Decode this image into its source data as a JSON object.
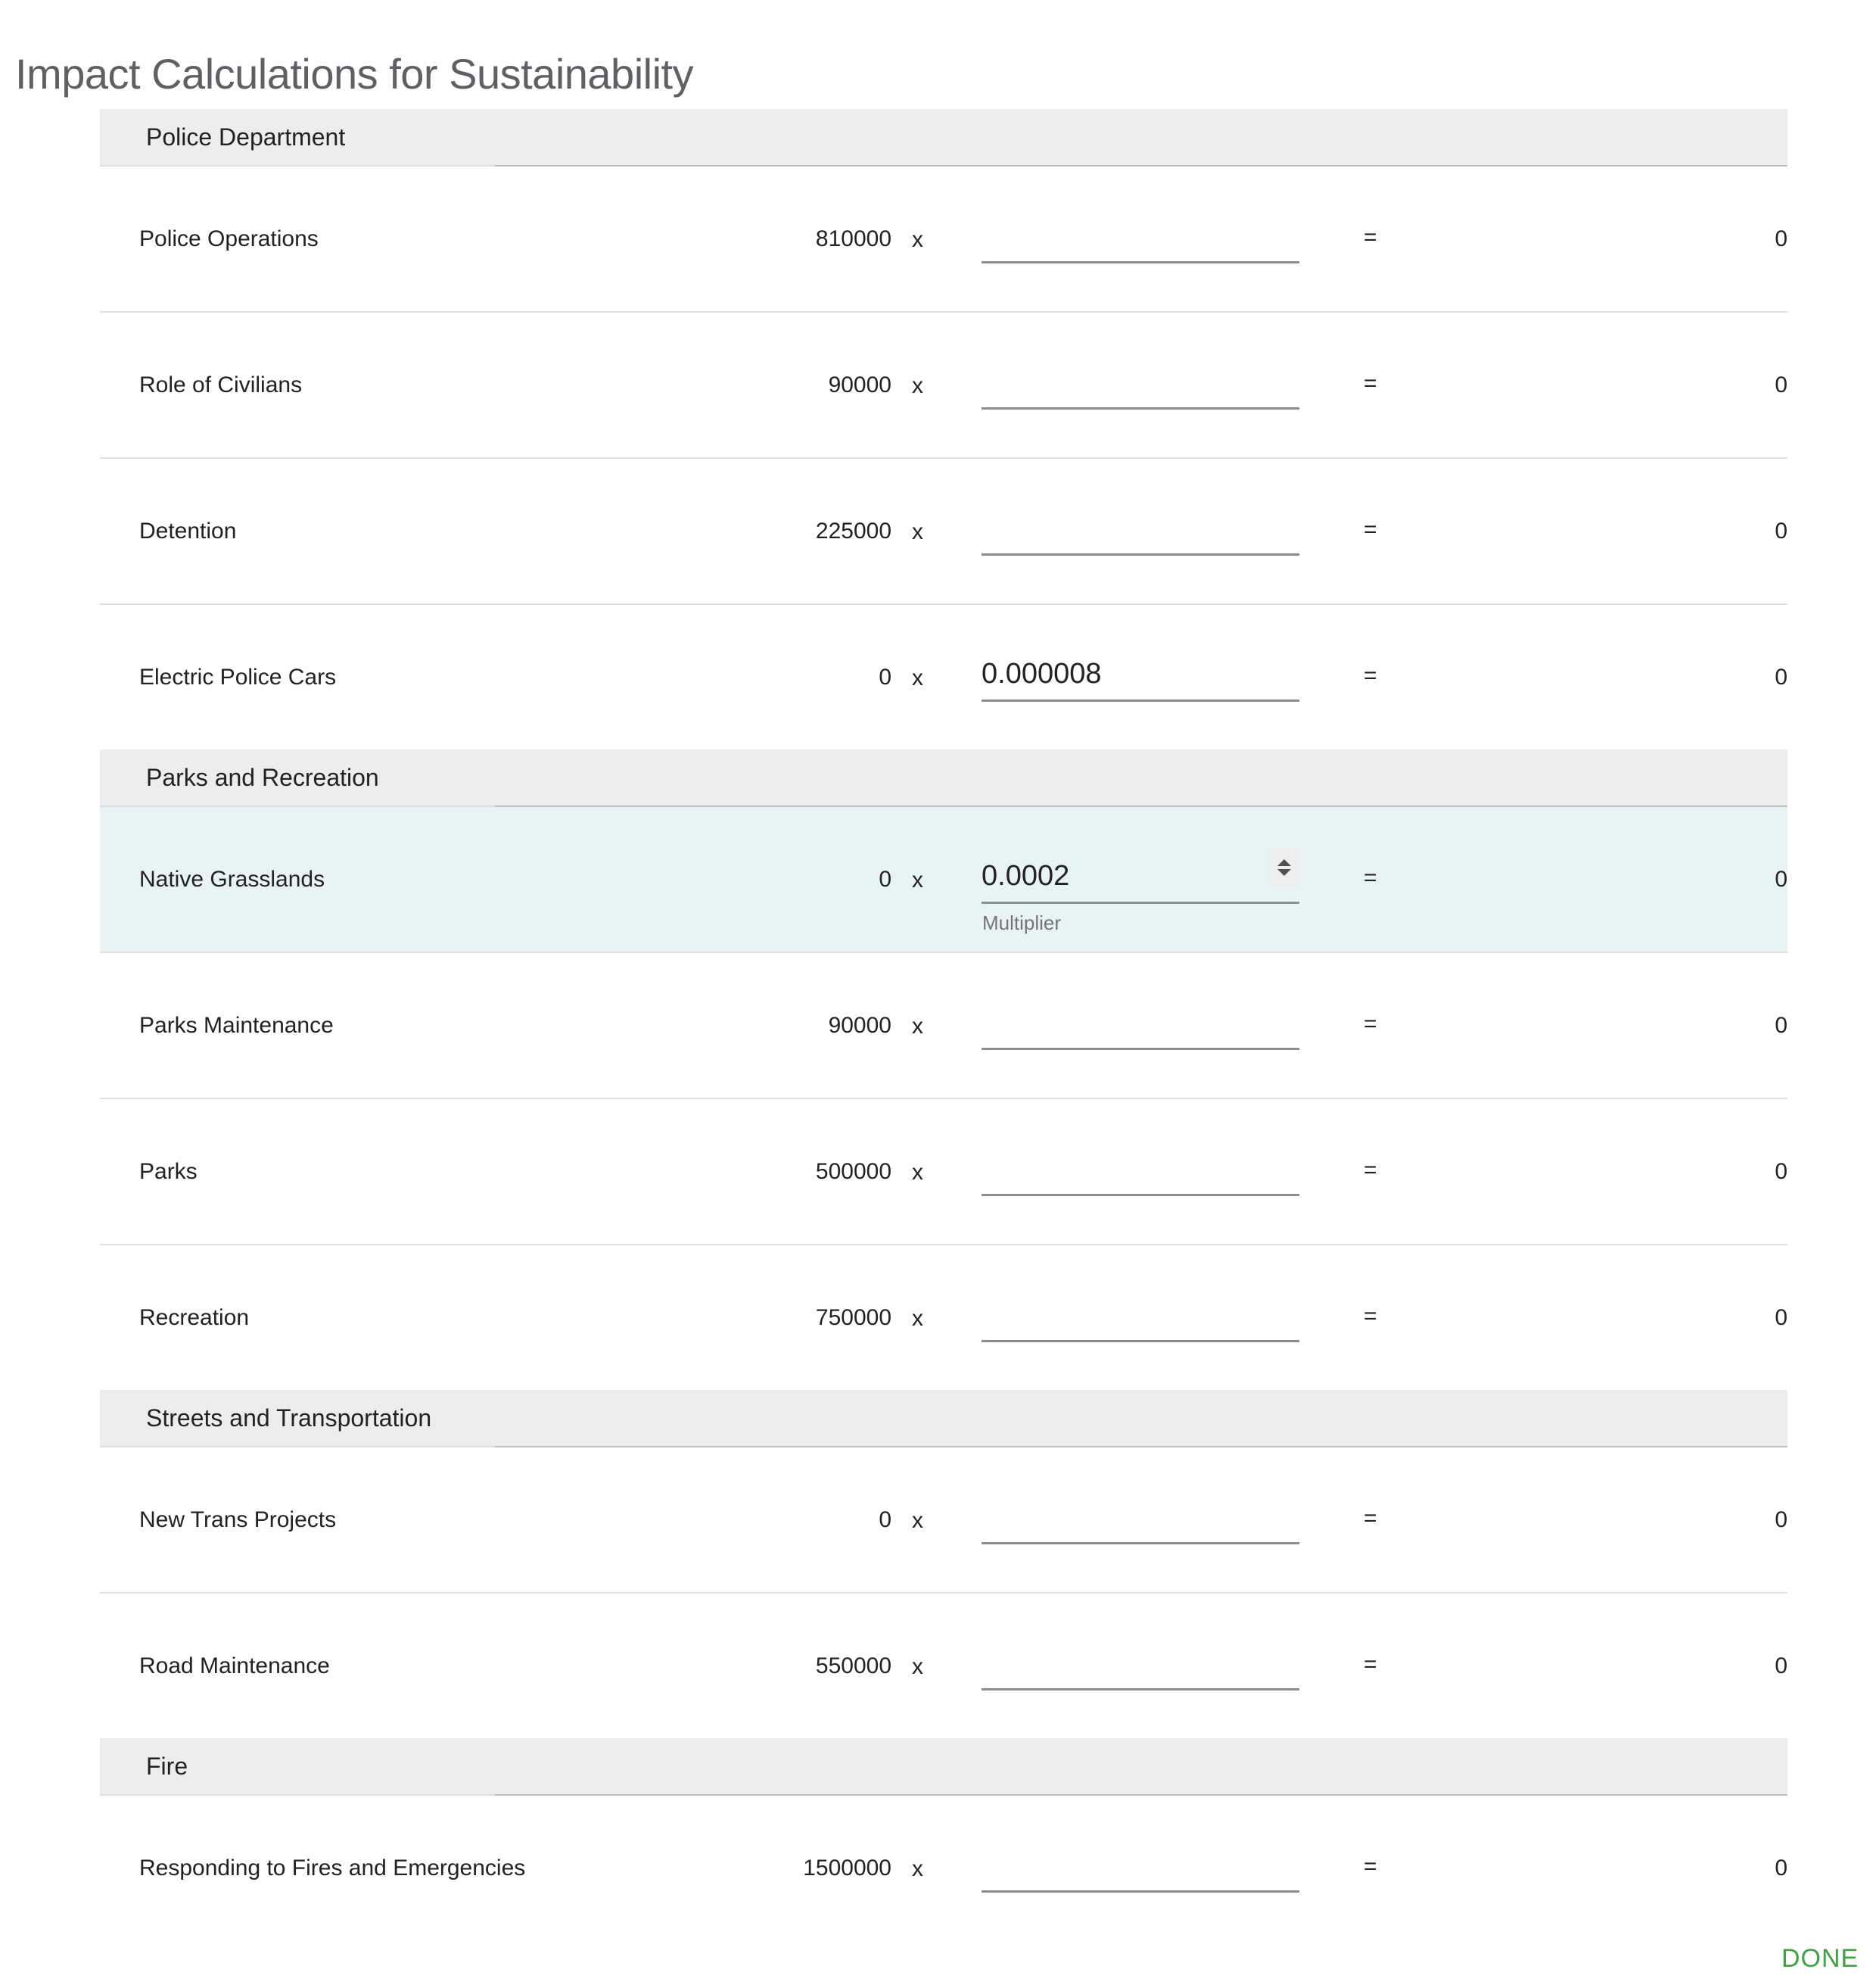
{
  "page": {
    "title": "Impact Calculations for Sustainability"
  },
  "sections": [
    {
      "title": "Police Department",
      "rows": [
        {
          "label": "Police Operations",
          "base": "810000",
          "times": "x",
          "multiplier": "",
          "equals": "=",
          "result": "0"
        },
        {
          "label": "Role of Civilians",
          "base": "90000",
          "times": "x",
          "multiplier": "",
          "equals": "=",
          "result": "0"
        },
        {
          "label": "Detention",
          "base": "225000",
          "times": "x",
          "multiplier": "",
          "equals": "=",
          "result": "0"
        },
        {
          "label": "Electric Police Cars",
          "base": "0",
          "times": "x",
          "multiplier": "0.000008",
          "equals": "=",
          "result": "0"
        }
      ]
    },
    {
      "title": "Parks and Recreation",
      "rows": [
        {
          "label": "Native Grasslands",
          "base": "0",
          "times": "x",
          "multiplier": "0.0002",
          "equals": "=",
          "result": "0",
          "focused": true,
          "helper": "Multiplier"
        },
        {
          "label": "Parks Maintenance",
          "base": "90000",
          "times": "x",
          "multiplier": "",
          "equals": "=",
          "result": "0"
        },
        {
          "label": "Parks",
          "base": "500000",
          "times": "x",
          "multiplier": "",
          "equals": "=",
          "result": "0"
        },
        {
          "label": "Recreation",
          "base": "750000",
          "times": "x",
          "multiplier": "",
          "equals": "=",
          "result": "0"
        }
      ]
    },
    {
      "title": "Streets and Transportation",
      "rows": [
        {
          "label": "New Trans Projects",
          "base": "0",
          "times": "x",
          "multiplier": "",
          "equals": "=",
          "result": "0"
        },
        {
          "label": "Road Maintenance",
          "base": "550000",
          "times": "x",
          "multiplier": "",
          "equals": "=",
          "result": "0"
        }
      ]
    },
    {
      "title": "Fire",
      "rows": [
        {
          "label": "Responding to Fires and Emergencies",
          "base": "1500000",
          "times": "x",
          "multiplier": "",
          "equals": "=",
          "result": "0"
        }
      ]
    }
  ],
  "actions": {
    "done_label": "DONE"
  },
  "colors": {
    "accent_green": "#43a047",
    "focused_row_bg": "#e8f4f4",
    "section_header_bg": "#ededed"
  }
}
